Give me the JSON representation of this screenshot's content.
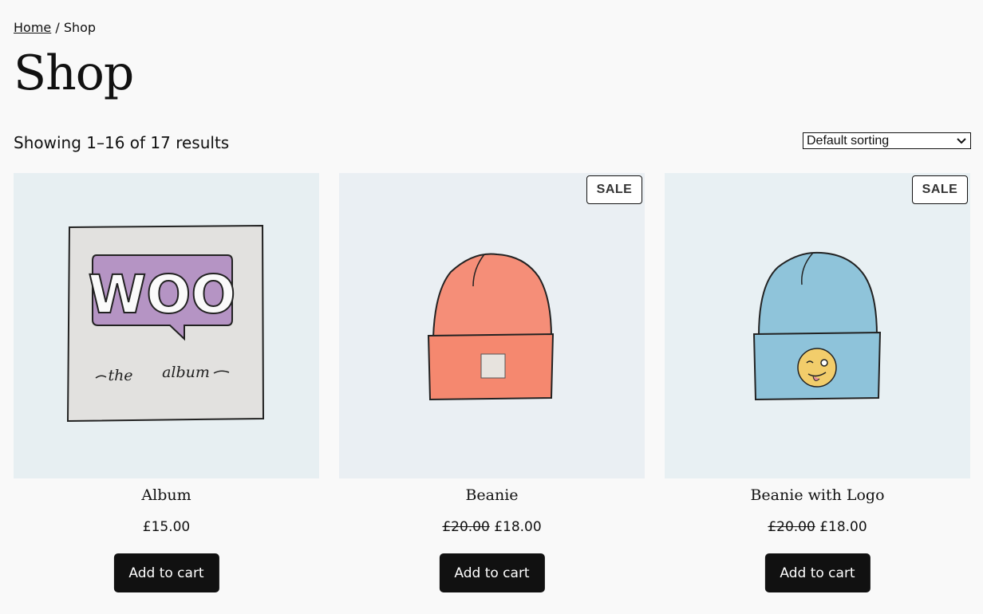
{
  "breadcrumb": {
    "home": "Home",
    "separator": " / ",
    "current": "Shop"
  },
  "page_title": "Shop",
  "result_count": "Showing 1–16 of 17 results",
  "sorting": {
    "selected": "Default sorting",
    "icon": "chevron-down-icon"
  },
  "colors": {
    "button_bg": "#111111",
    "page_bg": "#f9f9f9",
    "image_bg": "#e8eff3"
  },
  "products": [
    {
      "name": "Album",
      "price": "£15.00",
      "regular_price": "",
      "sale": false,
      "sale_label": "",
      "button": "Add to cart",
      "image": "woo-album-image"
    },
    {
      "name": "Beanie",
      "price": "£18.00",
      "regular_price": "£20.00",
      "sale": true,
      "sale_label": "SALE",
      "button": "Add to cart",
      "image": "orange-beanie-image"
    },
    {
      "name": "Beanie with Logo",
      "price": "£18.00",
      "regular_price": "£20.00",
      "sale": true,
      "sale_label": "SALE",
      "button": "Add to cart",
      "image": "blue-beanie-logo-image"
    }
  ],
  "album_art": {
    "logo_text": "WOO",
    "subtitle_left": "the",
    "subtitle_right": "album"
  }
}
